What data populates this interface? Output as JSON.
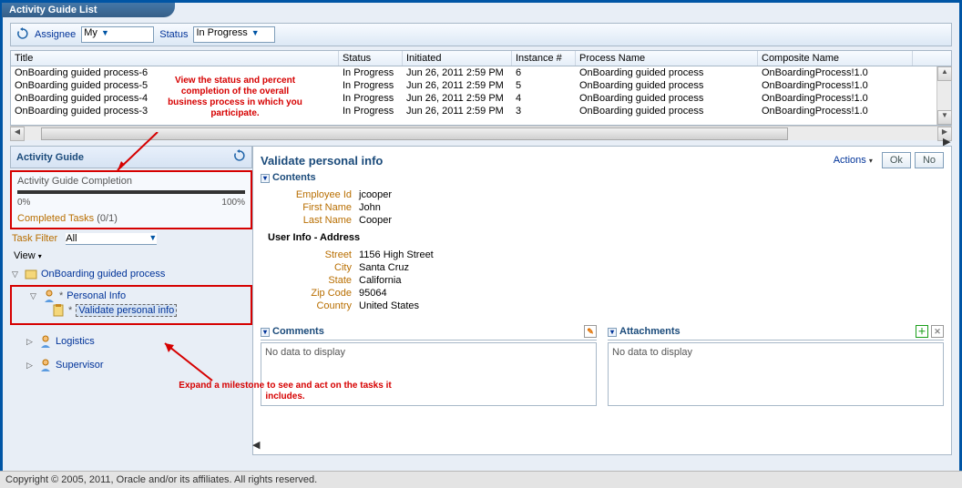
{
  "titlebar": "Activity Guide List",
  "toolbar": {
    "refresh_icon": "refresh",
    "assignee_label": "Assignee",
    "assignee_value": "My",
    "status_label": "Status",
    "status_value": "In Progress"
  },
  "grid": {
    "headers": [
      "Title",
      "Status",
      "Initiated",
      "Instance #",
      "Process Name",
      "Composite Name"
    ],
    "rows": [
      {
        "title": "OnBoarding guided process-6",
        "status": "In Progress",
        "initiated": "Jun 26, 2011 2:59 PM",
        "instance": "6",
        "process": "OnBoarding guided process",
        "composite": "OnBoardingProcess!1.0"
      },
      {
        "title": "OnBoarding guided process-5",
        "status": "In Progress",
        "initiated": "Jun 26, 2011 2:59 PM",
        "instance": "5",
        "process": "OnBoarding guided process",
        "composite": "OnBoardingProcess!1.0"
      },
      {
        "title": "OnBoarding guided process-4",
        "status": "In Progress",
        "initiated": "Jun 26, 2011 2:59 PM",
        "instance": "4",
        "process": "OnBoarding guided process",
        "composite": "OnBoardingProcess!1.0"
      },
      {
        "title": "OnBoarding guided process-3",
        "status": "In Progress",
        "initiated": "Jun 26, 2011 2:59 PM",
        "instance": "3",
        "process": "OnBoarding guided process",
        "composite": "OnBoardingProcess!1.0"
      }
    ]
  },
  "left": {
    "header": "Activity Guide",
    "completion": {
      "title": "Activity Guide Completion",
      "left": "0%",
      "right": "100%",
      "tasks_label": "Completed Tasks",
      "tasks_count": "(0/1)"
    },
    "filter_label": "Task Filter",
    "filter_value": "All",
    "view_label": "View",
    "tree": {
      "root": "OnBoarding guided process",
      "personal": "Personal Info",
      "validate": "Validate personal info",
      "logistics": "Logistics",
      "supervisor": "Supervisor"
    }
  },
  "right": {
    "title": "Validate personal info",
    "actions": "Actions",
    "ok": "Ok",
    "no": "No",
    "contents_label": "Contents",
    "fields": {
      "emp_id_k": "Employee Id",
      "emp_id_v": "jcooper",
      "first_k": "First Name",
      "first_v": "John",
      "last_k": "Last Name",
      "last_v": "Cooper",
      "addr_header": "User Info - Address",
      "street_k": "Street",
      "street_v": "1156 High Street",
      "city_k": "City",
      "city_v": "Santa Cruz",
      "state_k": "State",
      "state_v": "California",
      "zip_k": "Zip Code",
      "zip_v": "95064",
      "country_k": "Country",
      "country_v": "United States"
    },
    "comments": {
      "label": "Comments",
      "empty": "No data to display"
    },
    "attachments": {
      "label": "Attachments",
      "empty": "No data to display"
    }
  },
  "annotations": {
    "top": "View the status and percent completion of the overall business process in which you participate.",
    "bottom": "Expand a milestone to see and act on the tasks it includes."
  },
  "footer": "Copyright © 2005, 2011, Oracle and/or its affiliates. All rights reserved."
}
